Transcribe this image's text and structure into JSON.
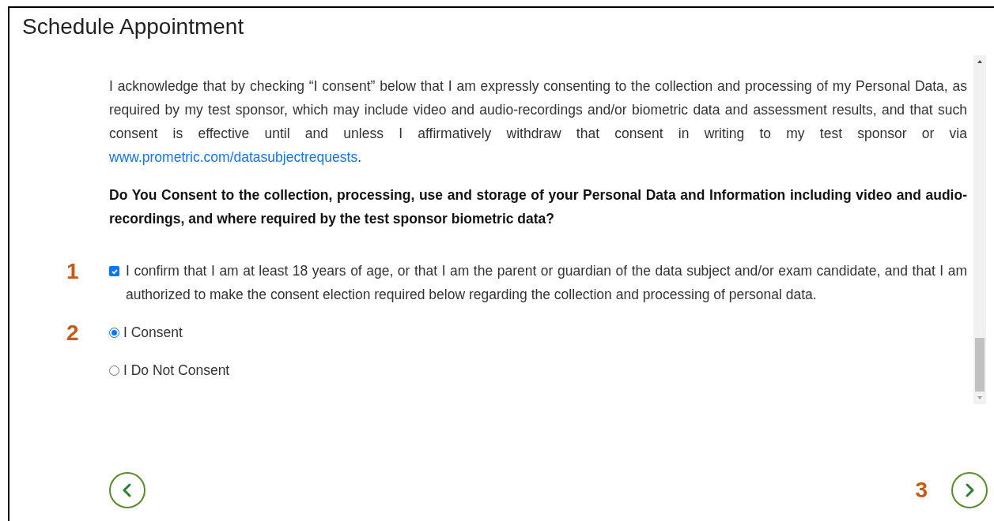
{
  "title": "Schedule Appointment",
  "consent_text": {
    "text": "I acknowledge that by checking “I consent” below that I am expressly consenting to the collection and processing of my Personal Data, as required by my test sponsor, which may include video and audio-recordings and/or biometric data and assessment results, and that such consent is effective until and unless I affirmatively withdraw that consent in writing to my test sponsor or via",
    "link": "www.prometric.com/datasubjectrequests",
    "after_link": "."
  },
  "question": "Do You Consent to the collection, processing, use and storage of your Personal Data and Information including video and audio-recordings, and where required by the test sponsor biometric data?",
  "confirm": {
    "marker": "1",
    "text": "I confirm that I am at least 18 years of age, or that I am the parent or guardian of the data subject and/or exam candidate, and that I am authorized to make the consent election required below regarding the collection and processing of personal data.",
    "checked": true
  },
  "options_marker": "2",
  "options": [
    {
      "label": "I Consent",
      "selected": true
    },
    {
      "label": "I Do Not Consent",
      "selected": false
    }
  ],
  "next_marker": "3"
}
